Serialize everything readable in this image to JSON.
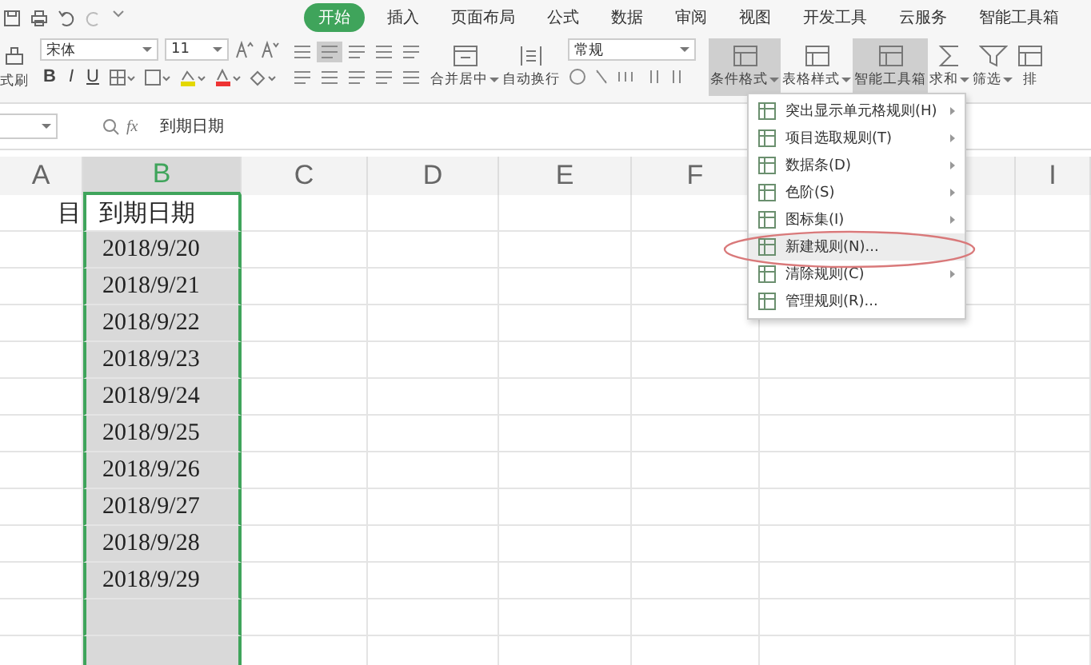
{
  "tabs": [
    {
      "label": "开始",
      "selected": true
    },
    {
      "label": "插入",
      "selected": false
    },
    {
      "label": "页面布局",
      "selected": false
    },
    {
      "label": "公式",
      "selected": false
    },
    {
      "label": "数据",
      "selected": false
    },
    {
      "label": "审阅",
      "selected": false
    },
    {
      "label": "视图",
      "selected": false
    },
    {
      "label": "开发工具",
      "selected": false
    },
    {
      "label": "云服务",
      "selected": false
    },
    {
      "label": "智能工具箱",
      "selected": false
    }
  ],
  "ribbon": {
    "format_painter": "式刷",
    "font_name": "宋体",
    "font_size": "11",
    "style_buttons": [
      "B",
      "I",
      "U"
    ],
    "merge": "合并居中",
    "merge_dropdown": true,
    "wrap": "自动换行",
    "number_format": "常规",
    "tools": [
      {
        "label": "条件格式",
        "dropdown": true,
        "selected": true
      },
      {
        "label": "表格样式",
        "dropdown": true,
        "selected": false
      },
      {
        "label": "智能工具箱",
        "dropdown": false,
        "selected": true
      },
      {
        "label": "求和",
        "dropdown": true,
        "selected": false
      },
      {
        "label": "筛选",
        "dropdown": true,
        "selected": false
      },
      {
        "label": "排",
        "dropdown": false,
        "selected": false
      }
    ]
  },
  "formula_bar": {
    "fx": "fx",
    "value": "到期日期"
  },
  "columns": [
    {
      "label": "A",
      "selected": false
    },
    {
      "label": "B",
      "selected": true
    },
    {
      "label": "C",
      "selected": false
    },
    {
      "label": "D",
      "selected": false
    },
    {
      "label": "E",
      "selected": false
    },
    {
      "label": "F",
      "selected": false
    },
    {
      "label": "I",
      "selected": false
    }
  ],
  "rows": [
    {
      "cells": [
        "目",
        "到期日期"
      ]
    },
    {
      "cells": [
        "",
        "2018/9/20"
      ]
    },
    {
      "cells": [
        "",
        "2018/9/21"
      ]
    },
    {
      "cells": [
        "",
        "2018/9/22"
      ]
    },
    {
      "cells": [
        "",
        "2018/9/23"
      ]
    },
    {
      "cells": [
        "",
        "2018/9/24"
      ]
    },
    {
      "cells": [
        "",
        "2018/9/25"
      ]
    },
    {
      "cells": [
        "",
        "2018/9/26"
      ]
    },
    {
      "cells": [
        "",
        "2018/9/27"
      ]
    },
    {
      "cells": [
        "",
        "2018/9/28"
      ]
    },
    {
      "cells": [
        "",
        "2018/9/29"
      ]
    },
    {
      "cells": [
        "",
        ""
      ]
    },
    {
      "cells": [
        "",
        ""
      ]
    }
  ],
  "menu": {
    "items": [
      {
        "label": "突出显示单元格规则(H)",
        "submenu": true,
        "highlighted": false
      },
      {
        "label": "项目选取规则(T)",
        "submenu": true,
        "highlighted": false
      },
      {
        "label": "数据条(D)",
        "submenu": true,
        "highlighted": false
      },
      {
        "label": "色阶(S)",
        "submenu": true,
        "highlighted": false
      },
      {
        "label": "图标集(I)",
        "submenu": true,
        "highlighted": false
      },
      {
        "label": "新建规则(N)...",
        "submenu": false,
        "highlighted": true
      },
      {
        "label": "清除规则(C)",
        "submenu": true,
        "highlighted": false
      },
      {
        "label": "管理规则(R)...",
        "submenu": false,
        "highlighted": false
      }
    ]
  }
}
